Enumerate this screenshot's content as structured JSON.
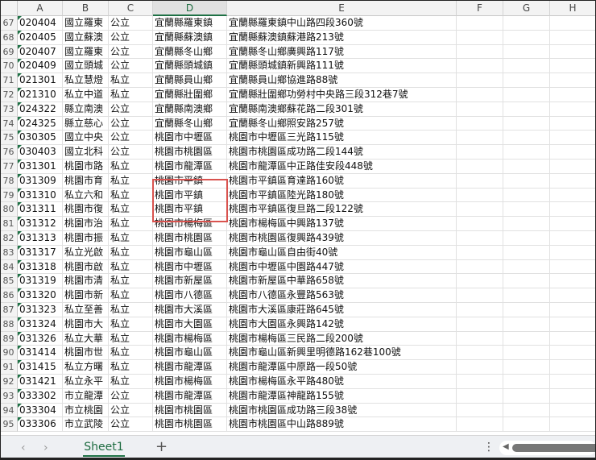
{
  "columns": [
    "A",
    "B",
    "C",
    "D",
    "E",
    "F",
    "G",
    "H"
  ],
  "selected_column": "D",
  "rows": [
    {
      "n": "67",
      "a": "020404",
      "b": "國立羅東",
      "c": "公立",
      "d": "宜蘭縣羅東鎮",
      "e": "宜蘭縣羅東鎮中山路四段360號"
    },
    {
      "n": "68",
      "a": "020405",
      "b": "國立蘇澳",
      "c": "公立",
      "d": "宜蘭縣蘇澳鎮",
      "e": "宜蘭縣蘇澳鎮蘇港路213號"
    },
    {
      "n": "69",
      "a": "020407",
      "b": "國立羅東",
      "c": "公立",
      "d": "宜蘭縣冬山鄉",
      "e": "宜蘭縣冬山鄉廣興路117號"
    },
    {
      "n": "70",
      "a": "020409",
      "b": "國立頭城",
      "c": "公立",
      "d": "宜蘭縣頭城鎮",
      "e": "宜蘭縣頭城鎮新興路111號"
    },
    {
      "n": "71",
      "a": "021301",
      "b": "私立慧燈",
      "c": "私立",
      "d": "宜蘭縣員山鄉",
      "e": "宜蘭縣員山鄉協進路88號"
    },
    {
      "n": "72",
      "a": "021310",
      "b": "私立中道",
      "c": "私立",
      "d": "宜蘭縣壯圍鄉",
      "e": "宜蘭縣壯圍鄉功勞村中央路三段312巷7號"
    },
    {
      "n": "73",
      "a": "024322",
      "b": "縣立南澳",
      "c": "公立",
      "d": "宜蘭縣南澳鄉",
      "e": "宜蘭縣南澳鄉蘇花路二段301號"
    },
    {
      "n": "74",
      "a": "024325",
      "b": "縣立慈心",
      "c": "公立",
      "d": "宜蘭縣冬山鄉",
      "e": "宜蘭縣冬山鄉照安路257號"
    },
    {
      "n": "75",
      "a": "030305",
      "b": "國立中央",
      "c": "公立",
      "d": "桃園市中壢區",
      "e": "桃園市中壢區三光路115號"
    },
    {
      "n": "76",
      "a": "030403",
      "b": "國立北科",
      "c": "公立",
      "d": "桃園市桃園區",
      "e": "桃園市桃園區成功路二段144號"
    },
    {
      "n": "77",
      "a": "031301",
      "b": "桃園市路",
      "c": "私立",
      "d": "桃園市龍潭區",
      "e": "桃園市龍潭區中正路佳安段448號"
    },
    {
      "n": "78",
      "a": "031309",
      "b": "桃園市育",
      "c": "私立",
      "d": "桃園市平鎮",
      "e": "桃園市平鎮區育達路160號"
    },
    {
      "n": "79",
      "a": "031310",
      "b": "私立六和",
      "c": "私立",
      "d": "桃園市平鎮",
      "e": "桃園市平鎮區陸光路180號"
    },
    {
      "n": "80",
      "a": "031311",
      "b": "桃園市復",
      "c": "私立",
      "d": "桃園市平鎮",
      "e": "桃園市平鎮區復旦路二段122號"
    },
    {
      "n": "81",
      "a": "031312",
      "b": "桃園市治",
      "c": "私立",
      "d": "桃園市楊梅區",
      "e": "桃園市楊梅區中興路137號"
    },
    {
      "n": "82",
      "a": "031313",
      "b": "桃園市振",
      "c": "私立",
      "d": "桃園市桃園區",
      "e": "桃園市桃園區復興路439號"
    },
    {
      "n": "83",
      "a": "031317",
      "b": "私立光啟",
      "c": "私立",
      "d": "桃園市龜山區",
      "e": "桃園市龜山區自由街40號"
    },
    {
      "n": "84",
      "a": "031318",
      "b": "桃園市啟",
      "c": "私立",
      "d": "桃園市中壢區",
      "e": "桃園市中壢區中園路447號"
    },
    {
      "n": "85",
      "a": "031319",
      "b": "桃園市清",
      "c": "私立",
      "d": "桃園市新屋區",
      "e": "桃園市新屋區中華路658號"
    },
    {
      "n": "86",
      "a": "031320",
      "b": "桃園市新",
      "c": "私立",
      "d": "桃園市八德區",
      "e": "桃園市八德區永豐路563號"
    },
    {
      "n": "87",
      "a": "031323",
      "b": "私立至善",
      "c": "私立",
      "d": "桃園市大溪區",
      "e": "桃園市大溪區康莊路645號"
    },
    {
      "n": "88",
      "a": "031324",
      "b": "桃園市大",
      "c": "私立",
      "d": "桃園市大園區",
      "e": "桃園市大園區永興路142號"
    },
    {
      "n": "89",
      "a": "031326",
      "b": "私立大華",
      "c": "私立",
      "d": "桃園市楊梅區",
      "e": "桃園市楊梅區三民路二段200號"
    },
    {
      "n": "90",
      "a": "031414",
      "b": "桃園市世",
      "c": "私立",
      "d": "桃園市龜山區",
      "e": "桃園市龜山區新興里明德路162巷100號"
    },
    {
      "n": "91",
      "a": "031415",
      "b": "私立方曙",
      "c": "私立",
      "d": "桃園市龍潭區",
      "e": "桃園市龍潭區中原路一段50號"
    },
    {
      "n": "92",
      "a": "031421",
      "b": "私立永平",
      "c": "私立",
      "d": "桃園市楊梅區",
      "e": "桃園市楊梅區永平路480號"
    },
    {
      "n": "93",
      "a": "033302",
      "b": "市立龍潭",
      "c": "公立",
      "d": "桃園市龍潭區",
      "e": "桃園市龍潭區神龍路155號"
    },
    {
      "n": "94",
      "a": "033304",
      "b": "市立桃園",
      "c": "公立",
      "d": "桃園市桃園區",
      "e": "桃園市桃園區成功路三段38號"
    },
    {
      "n": "95",
      "a": "033306",
      "b": "市立武陵",
      "c": "公立",
      "d": "桃園市桃園區",
      "e": "桃園市桃園區中山路889號"
    }
  ],
  "sheet_tab": "Sheet1",
  "add_sheet": "+",
  "nav_prev": "‹",
  "nav_next": "›",
  "options": "⋮",
  "scroll_left": "◀"
}
